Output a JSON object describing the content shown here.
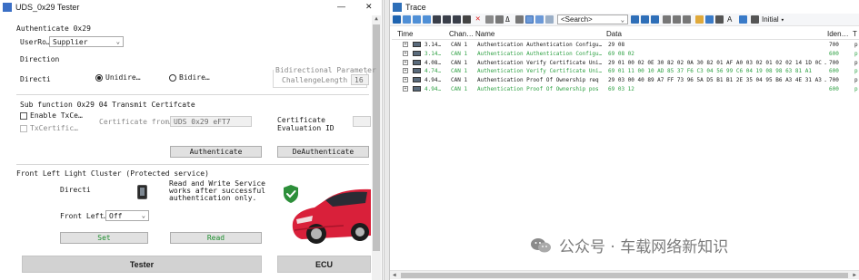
{
  "left_window": {
    "title": "UDS_0x29 Tester",
    "controls": {
      "minimize": "—",
      "close": "✕"
    },
    "section_auth": "Authenticate 0x29",
    "user_role_label": "UserRo…",
    "user_role_value": "Supplier",
    "direction_label": "Direction",
    "direction_field": "Directi",
    "radio_uni": "Unidire…",
    "radio_bi": "Bidire…",
    "bidir_param_label": "Bidirectional Parameter",
    "challenge_label": "ChallengeLength (…",
    "challenge_value": "16",
    "subfunc_label": "Sub function 0x29 04 Transmit Certifcate",
    "enable_tx_label": "Enable TxCe…",
    "tx_cert_label": "TxCertific…",
    "cert_from_label": "Certificate from…",
    "cert_from_value": "UDS 0x29 eFT7",
    "cert_eval_label": "Certificate\nEvaluation ID",
    "auth_button": "Authenticate",
    "deauth_button": "DeAuthenticate",
    "front_cluster_label": "Front Left Light Cluster (Protected service)",
    "cluster_direction": "Directi",
    "rw_service_text": "Read and Write Service\nworks after successful\nauthentication only.",
    "front_left_label": "Front Left…",
    "front_left_value": "Off",
    "set_button": "Set",
    "read_button": "Read",
    "tester_tab": "Tester",
    "ecu_tab": "ECU",
    "colors": {
      "accent_green": "#1e8e2e",
      "shield_green": "#2d8f3a",
      "car_red": "#d9203a"
    }
  },
  "trace_window": {
    "title": "Trace",
    "search_placeholder": "<Search>",
    "initial_label": "Initial",
    "columns": [
      "Time",
      "Chan…",
      "Name",
      "Data",
      "Iden…",
      "T"
    ],
    "rows": [
      {
        "time": "3.14…",
        "chan": "CAN 1",
        "name": "Authentication Authentication Configu…",
        "data": "29 08",
        "id": "700",
        "t": "p",
        "dir": "tx"
      },
      {
        "time": "3.14…",
        "chan": "CAN 1",
        "name": "Authentication Authentication Configu…",
        "data": "69 08 02",
        "id": "600",
        "t": "p",
        "dir": "rx"
      },
      {
        "time": "4.08…",
        "chan": "CAN 1",
        "name": "Authentication Verify Certificate Uni…",
        "data": "29 01 00 02 0E 30 82 02 0A 30 82 01 AF A0 03 02 01 02 02 14 1D 0C …",
        "id": "700",
        "t": "p",
        "dir": "tx"
      },
      {
        "time": "4.74…",
        "chan": "CAN 1",
        "name": "Authentication Verify Certificate Uni…",
        "data": "69 01 11 00 10 AD 85 37 F6 C3 04 56 99 C6 04 19 08 98 63 81 A1",
        "id": "600",
        "t": "p",
        "dir": "rx"
      },
      {
        "time": "4.94…",
        "chan": "CAN 1",
        "name": "Authentication Proof Of Ownership req",
        "data": "29 03 00 40 89 A7 FF 73 96 5A D5 B1 B1 2E 35 04 95 B6 A3 4E 31 A3 …",
        "id": "700",
        "t": "p",
        "dir": "tx"
      },
      {
        "time": "4.94…",
        "chan": "CAN 1",
        "name": "Authentication Proof Of Ownership pos",
        "data": "69 03 12",
        "id": "600",
        "t": "p",
        "dir": "rx"
      }
    ],
    "colors": {
      "rx": "#2ea043",
      "tx": "#1a1a1a"
    }
  },
  "watermark": "公众号 · 车载网络新知识"
}
